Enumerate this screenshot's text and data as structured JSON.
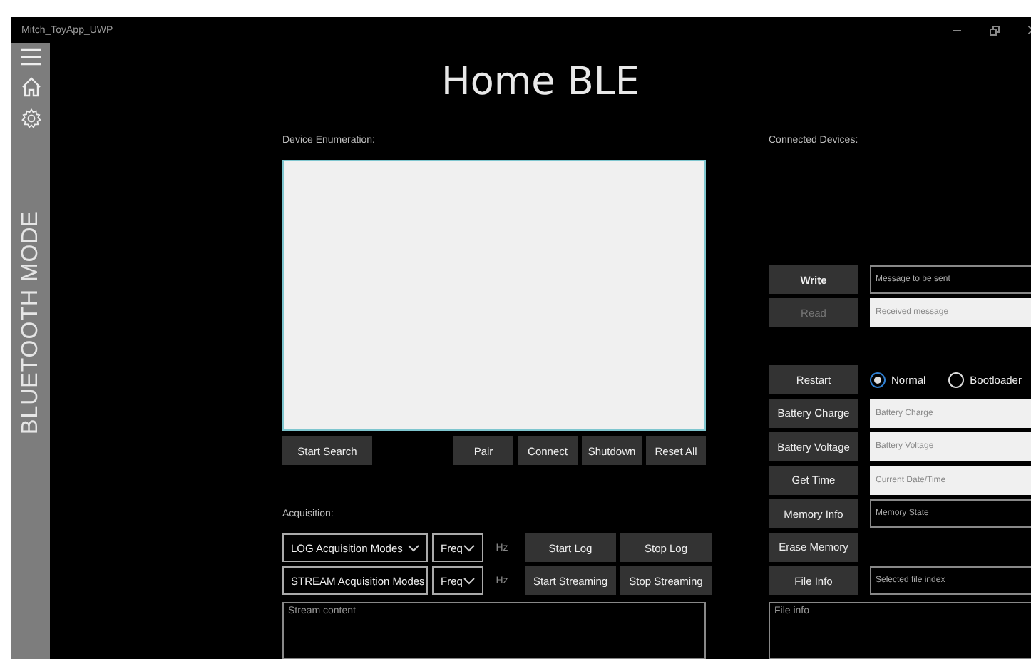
{
  "window": {
    "title": "Mitch_ToyApp_UWP"
  },
  "sidebar": {
    "label": "BLUETOOTH MODE"
  },
  "page_title": "Home BLE",
  "device_enumeration": {
    "label": "Device Enumeration:",
    "left_buttons": [
      "Start Search"
    ],
    "right_buttons": [
      "Pair",
      "Connect",
      "Shutdown",
      "Reset All"
    ]
  },
  "acquisition": {
    "label": "Acquisition:",
    "rows": [
      {
        "mode": "LOG Acquisition Modes",
        "freq": "Freq",
        "unit": "Hz",
        "buttons": [
          "Start Log",
          "Stop Log"
        ]
      },
      {
        "mode": "STREAM Acquisition Modes",
        "freq": "Freq",
        "unit": "Hz",
        "buttons": [
          "Start Streaming",
          "Stop Streaming"
        ]
      }
    ],
    "stream": {
      "placeholder": "Stream content"
    }
  },
  "connected_devices": {
    "label": "Connected Devices:",
    "message_rows": [
      {
        "kind": "field",
        "button": {
          "label": "Write",
          "disabled": false
        },
        "field": {
          "placeholder": "Message to be sent",
          "readonly": false
        }
      },
      {
        "kind": "field",
        "button": {
          "label": "Read",
          "disabled": true
        },
        "field": {
          "placeholder": "Received message",
          "readonly": true
        }
      }
    ],
    "command_rows": [
      {
        "kind": "radio",
        "button": {
          "label": "Restart",
          "disabled": false
        },
        "options": [
          {
            "label": "Normal",
            "selected": true
          },
          {
            "label": "Bootloader",
            "selected": false
          }
        ]
      },
      {
        "kind": "field",
        "button": {
          "label": "Battery Charge",
          "disabled": false
        },
        "field": {
          "placeholder": "Battery Charge",
          "readonly": true
        }
      },
      {
        "kind": "field",
        "button": {
          "label": "Battery Voltage",
          "disabled": false
        },
        "field": {
          "placeholder": "Battery Voltage",
          "readonly": true
        }
      },
      {
        "kind": "field",
        "button": {
          "label": "Get Time",
          "disabled": false
        },
        "field": {
          "placeholder": "Current Date/Time",
          "readonly": true
        }
      },
      {
        "kind": "field",
        "button": {
          "label": "Memory Info",
          "disabled": false
        },
        "field": {
          "placeholder": "Memory State",
          "readonly": false
        }
      },
      {
        "kind": "button",
        "button": {
          "label": "Erase Memory",
          "disabled": false
        }
      },
      {
        "kind": "field",
        "button": {
          "label": "File Info",
          "disabled": false
        },
        "field": {
          "placeholder": "Selected file index",
          "readonly": false
        }
      }
    ],
    "file_info": {
      "placeholder": "File info"
    }
  }
}
